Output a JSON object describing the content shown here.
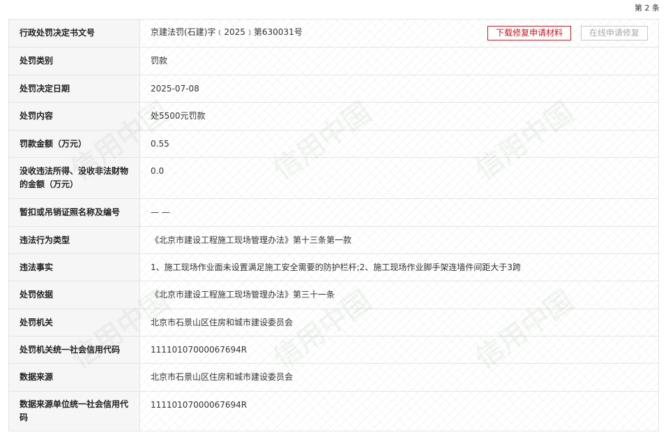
{
  "page_count": "第 2 条",
  "watermark_text": "信用中国",
  "buttons": {
    "download": "下载修复申请材料",
    "online": "在线申请修复"
  },
  "rows": [
    {
      "label": "行政处罚决定书文号",
      "value": "京建法罚(石建)字﹝2025﹞第630031号"
    },
    {
      "label": "处罚类别",
      "value": "罚款"
    },
    {
      "label": "处罚决定日期",
      "value": "2025-07-08"
    },
    {
      "label": "处罚内容",
      "value": "处5500元罚款"
    },
    {
      "label": "罚款金额（万元）",
      "value": "0.55"
    },
    {
      "label": "没收违法所得、没收非法财物的金额（万元）",
      "value": "0.0"
    },
    {
      "label": "暂扣或吊销证照名称及编号",
      "value": "— —"
    },
    {
      "label": "违法行为类型",
      "value": "《北京市建设工程施工现场管理办法》第十三条第一款"
    },
    {
      "label": "违法事实",
      "value": "1、施工现场作业面未设置满足施工安全需要的防护栏杆;2、施工现场作业脚手架连墙件间距大于3跨"
    },
    {
      "label": "处罚依据",
      "value": "《北京市建设工程施工现场管理办法》第三十一条"
    },
    {
      "label": "处罚机关",
      "value": "北京市石景山区住房和城市建设委员会"
    },
    {
      "label": "处罚机关统一社会信用代码",
      "value": "11110107000067694R"
    },
    {
      "label": "数据来源",
      "value": "北京市石景山区住房和城市建设委员会"
    },
    {
      "label": "数据来源单位统一社会信用代码",
      "value": "11110107000067694R"
    }
  ]
}
